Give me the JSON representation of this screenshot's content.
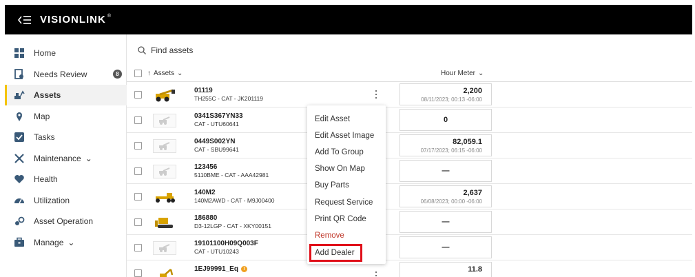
{
  "header": {
    "logo_text": "VISIONLINK",
    "logo_trademark": "®"
  },
  "sidebar": {
    "items": [
      {
        "label": "Home",
        "icon": "home-icon"
      },
      {
        "label": "Needs Review",
        "icon": "review-icon",
        "badge": "8"
      },
      {
        "label": "Assets",
        "icon": "assets-icon",
        "active": true
      },
      {
        "label": "Map",
        "icon": "map-icon"
      },
      {
        "label": "Tasks",
        "icon": "tasks-icon"
      },
      {
        "label": "Maintenance",
        "icon": "maintenance-icon",
        "expandable": true
      },
      {
        "label": "Health",
        "icon": "health-icon"
      },
      {
        "label": "Utilization",
        "icon": "utilization-icon"
      },
      {
        "label": "Asset Operation",
        "icon": "asset-operation-icon"
      },
      {
        "label": "Manage",
        "icon": "manage-icon",
        "expandable": true
      }
    ]
  },
  "search": {
    "placeholder": "Find assets"
  },
  "table": {
    "columns": {
      "assets": "Assets",
      "hour_meter": "Hour Meter"
    },
    "rows": [
      {
        "id": "01119",
        "desc": "TH255C - CAT - JK201119",
        "hours": "2,200",
        "time": "08/11/2023; 00:13 -06:00",
        "thumb": "telehandler"
      },
      {
        "id": "0341S367YN33",
        "desc": "CAT - UTU60641",
        "hours": "0",
        "time": "",
        "thumb": "placeholder"
      },
      {
        "id": "0449S002YN",
        "desc": "CAT - SBU99641",
        "hours": "82,059.1",
        "time": "07/17/2023; 06:15 -06:00",
        "thumb": "placeholder"
      },
      {
        "id": "123456",
        "desc": "5110BME - CAT - AAA42981",
        "hours": "—",
        "time": "",
        "thumb": "placeholder"
      },
      {
        "id": "140M2",
        "desc": "140M2AWD - CAT - M9J00400",
        "hours": "2,637",
        "time": "06/08/2023; 00:00 -06:00",
        "thumb": "grader"
      },
      {
        "id": "186880",
        "desc": "D3-12LGP - CAT - XKY00151",
        "hours": "—",
        "time": "",
        "thumb": "dozer"
      },
      {
        "id": "19101100H09Q003F",
        "desc": "CAT - UTU10243",
        "hours": "—",
        "time": "",
        "thumb": "placeholder"
      },
      {
        "id": "1EJ99991_Eq",
        "desc": "",
        "hours": "11.8",
        "time": "",
        "thumb": "excavator",
        "warning": true
      }
    ]
  },
  "context_menu": {
    "items": [
      "Edit Asset",
      "Edit Asset Image",
      "Add To Group",
      "Show On Map",
      "Buy Parts",
      "Request Service",
      "Print QR Code",
      "Remove",
      "Add Dealer"
    ],
    "highlighted": "Add Dealer"
  },
  "colors": {
    "accent": "#f5c400",
    "topbar": "#000000",
    "remove": "#c0392b",
    "highlight": "#e0101a"
  }
}
